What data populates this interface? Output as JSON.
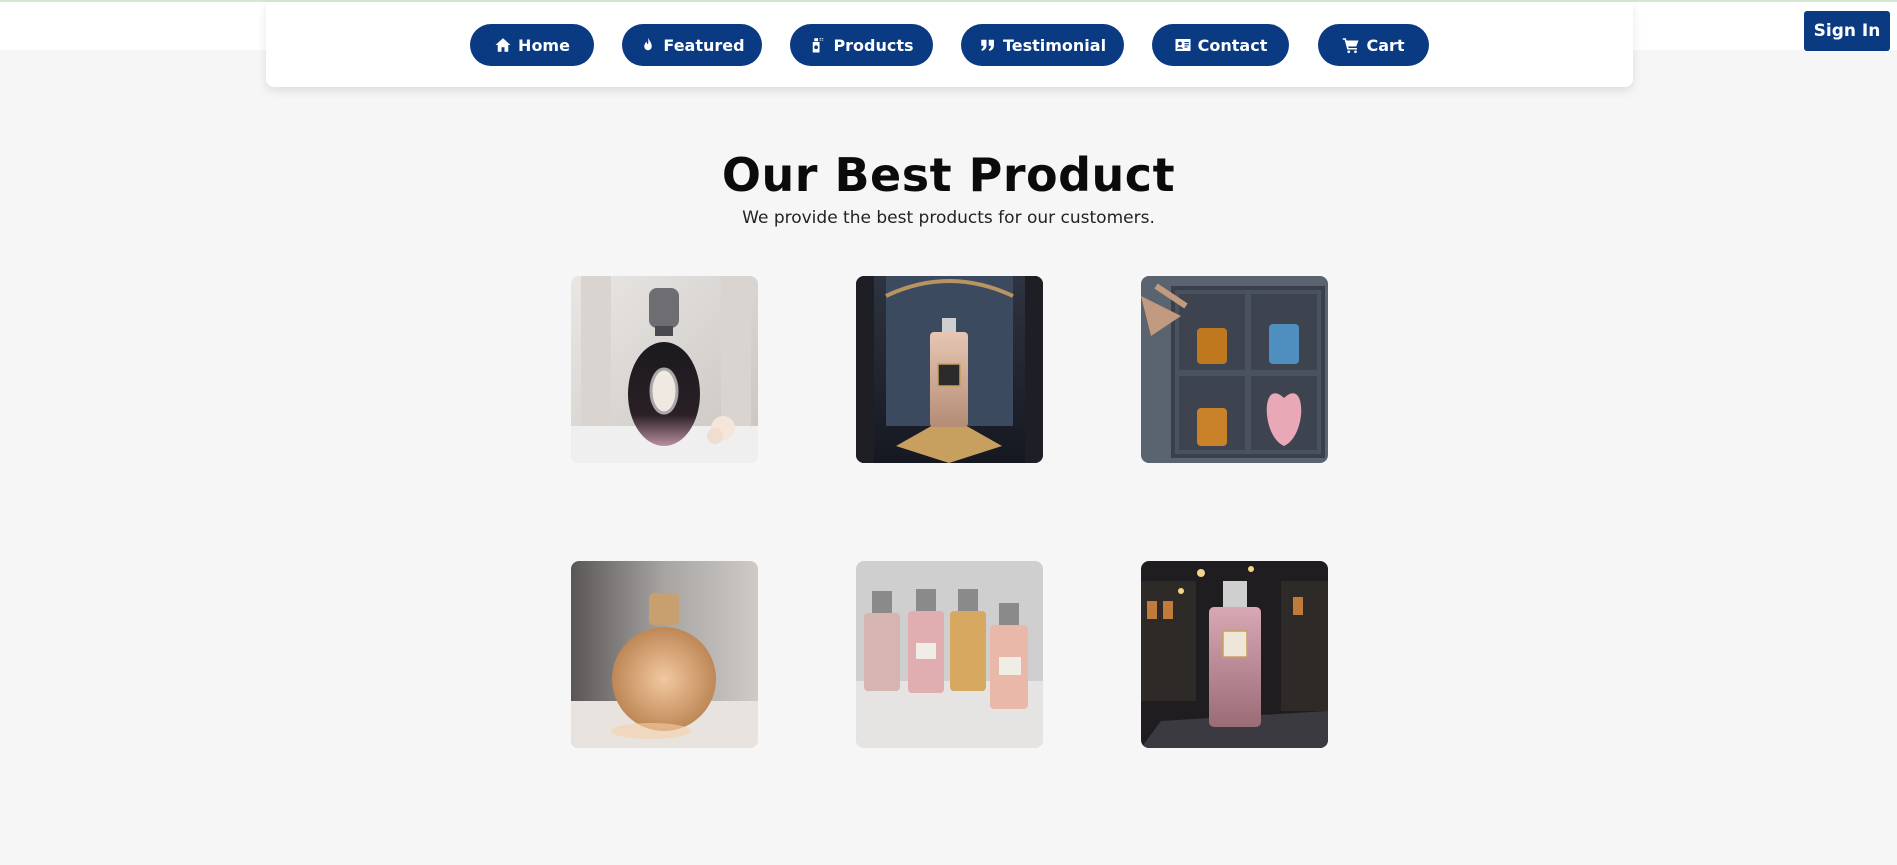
{
  "nav": {
    "items": [
      {
        "label": "Home",
        "icon": "home-icon"
      },
      {
        "label": "Featured",
        "icon": "flame-icon"
      },
      {
        "label": "Products",
        "icon": "perfume-bottle-icon"
      },
      {
        "label": "Testimonial",
        "icon": "quote-icon"
      },
      {
        "label": "Contact",
        "icon": "contact-card-icon"
      },
      {
        "label": "Cart",
        "icon": "cart-icon"
      }
    ],
    "sign_in": "Sign In"
  },
  "section": {
    "title": "Our Best Product",
    "subtitle": "We provide the best products for our customers."
  },
  "products": [
    {
      "image": "perfume-image"
    },
    {
      "image": "perfume-image"
    },
    {
      "image": "perfume-gift-box-image"
    },
    {
      "image": "perfume-image"
    },
    {
      "image": "perfume-set-image"
    },
    {
      "image": "perfume-image"
    }
  ],
  "colors": {
    "accent": "#0a3a82",
    "background": "#f6f6f6"
  }
}
